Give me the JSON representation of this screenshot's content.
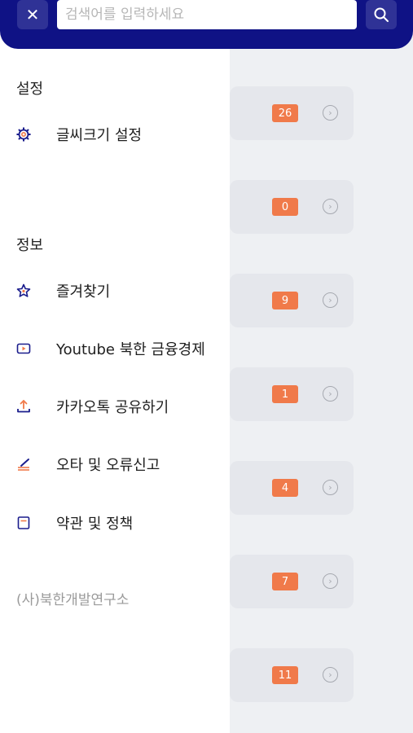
{
  "search": {
    "placeholder": "검색어를 입력하세요",
    "value": ""
  },
  "drawer": {
    "settings_title": "설정",
    "settings_items": [
      {
        "label": "글씨크기 설정",
        "icon": "gear-icon"
      }
    ],
    "info_title": "정보",
    "info_items": [
      {
        "label": "즐겨찾기",
        "icon": "star-icon"
      },
      {
        "label": "Youtube 북한 금융경제",
        "icon": "youtube-icon"
      },
      {
        "label": "카카오톡 공유하기",
        "icon": "share-icon"
      },
      {
        "label": "오타 및 오류신고",
        "icon": "edit-icon"
      },
      {
        "label": "약관 및 정책",
        "icon": "document-icon"
      }
    ],
    "footer": "(사)북한개발연구소"
  },
  "background_list": {
    "counts": [
      "26",
      "0",
      "9",
      "1",
      "4",
      "7",
      "11"
    ]
  },
  "colors": {
    "header": "#0f1285",
    "badge": "#f07a4a",
    "icon_navy": "#1a1c8c",
    "icon_orange": "#f07a4a"
  }
}
